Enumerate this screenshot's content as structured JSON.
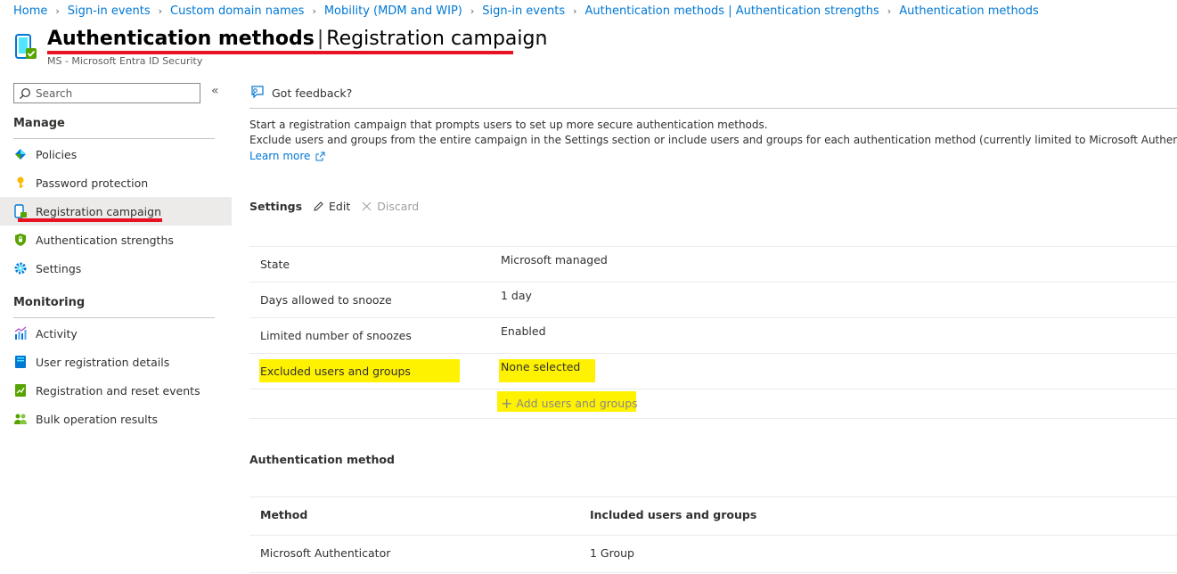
{
  "breadcrumb": [
    "Home",
    "Sign-in events",
    "Custom domain names",
    "Mobility (MDM and WIP)",
    "Sign-in events",
    "Authentication methods | Authentication strengths",
    "Authentication methods"
  ],
  "header": {
    "title_strong": "Authentication methods",
    "title_sep": "|",
    "title_light": "Registration campaign",
    "more": "···",
    "subtitle": "MS - Microsoft Entra ID Security"
  },
  "sidebar": {
    "search_placeholder": "Search",
    "collapse": "«",
    "manage_heading": "Manage",
    "manage_items": [
      {
        "label": "Policies",
        "icon": "policies-icon"
      },
      {
        "label": "Password protection",
        "icon": "key-icon"
      },
      {
        "label": "Registration campaign",
        "icon": "registration-campaign-icon",
        "active": true
      },
      {
        "label": "Authentication strengths",
        "icon": "shield-icon"
      },
      {
        "label": "Settings",
        "icon": "gear-icon"
      }
    ],
    "monitoring_heading": "Monitoring",
    "monitoring_items": [
      {
        "label": "Activity",
        "icon": "activity-chart-icon"
      },
      {
        "label": "User registration details",
        "icon": "user-details-icon"
      },
      {
        "label": "Registration and reset events",
        "icon": "events-icon"
      },
      {
        "label": "Bulk operation results",
        "icon": "bulk-users-icon"
      }
    ]
  },
  "cmdbar": {
    "feedback": "Got feedback?"
  },
  "description": {
    "line1": "Start a registration campaign that prompts users to set up more secure authentication methods.",
    "line2": "Exclude users and groups from the entire campaign in the Settings section or include users and groups for each authentication method (currently limited to Microsoft Authenticator).",
    "learn_more": "Learn more"
  },
  "settings": {
    "label": "Settings",
    "edit": "Edit",
    "discard": "Discard",
    "rows": [
      {
        "label": "State",
        "value": "Microsoft managed"
      },
      {
        "label": "Days allowed to snooze",
        "value": "1 day"
      },
      {
        "label": "Limited number of snoozes",
        "value": "Enabled"
      },
      {
        "label": "Excluded users and groups",
        "value": "None selected"
      }
    ],
    "add_users": "Add users and groups"
  },
  "auth_method": {
    "heading": "Authentication method",
    "columns": [
      "Method",
      "Included users and groups"
    ],
    "rows": [
      {
        "method": "Microsoft Authenticator",
        "included": "1 Group"
      }
    ]
  },
  "colors": {
    "accent": "#0078d4",
    "highlight": "#fff200",
    "annotation_red": "#e81123"
  }
}
